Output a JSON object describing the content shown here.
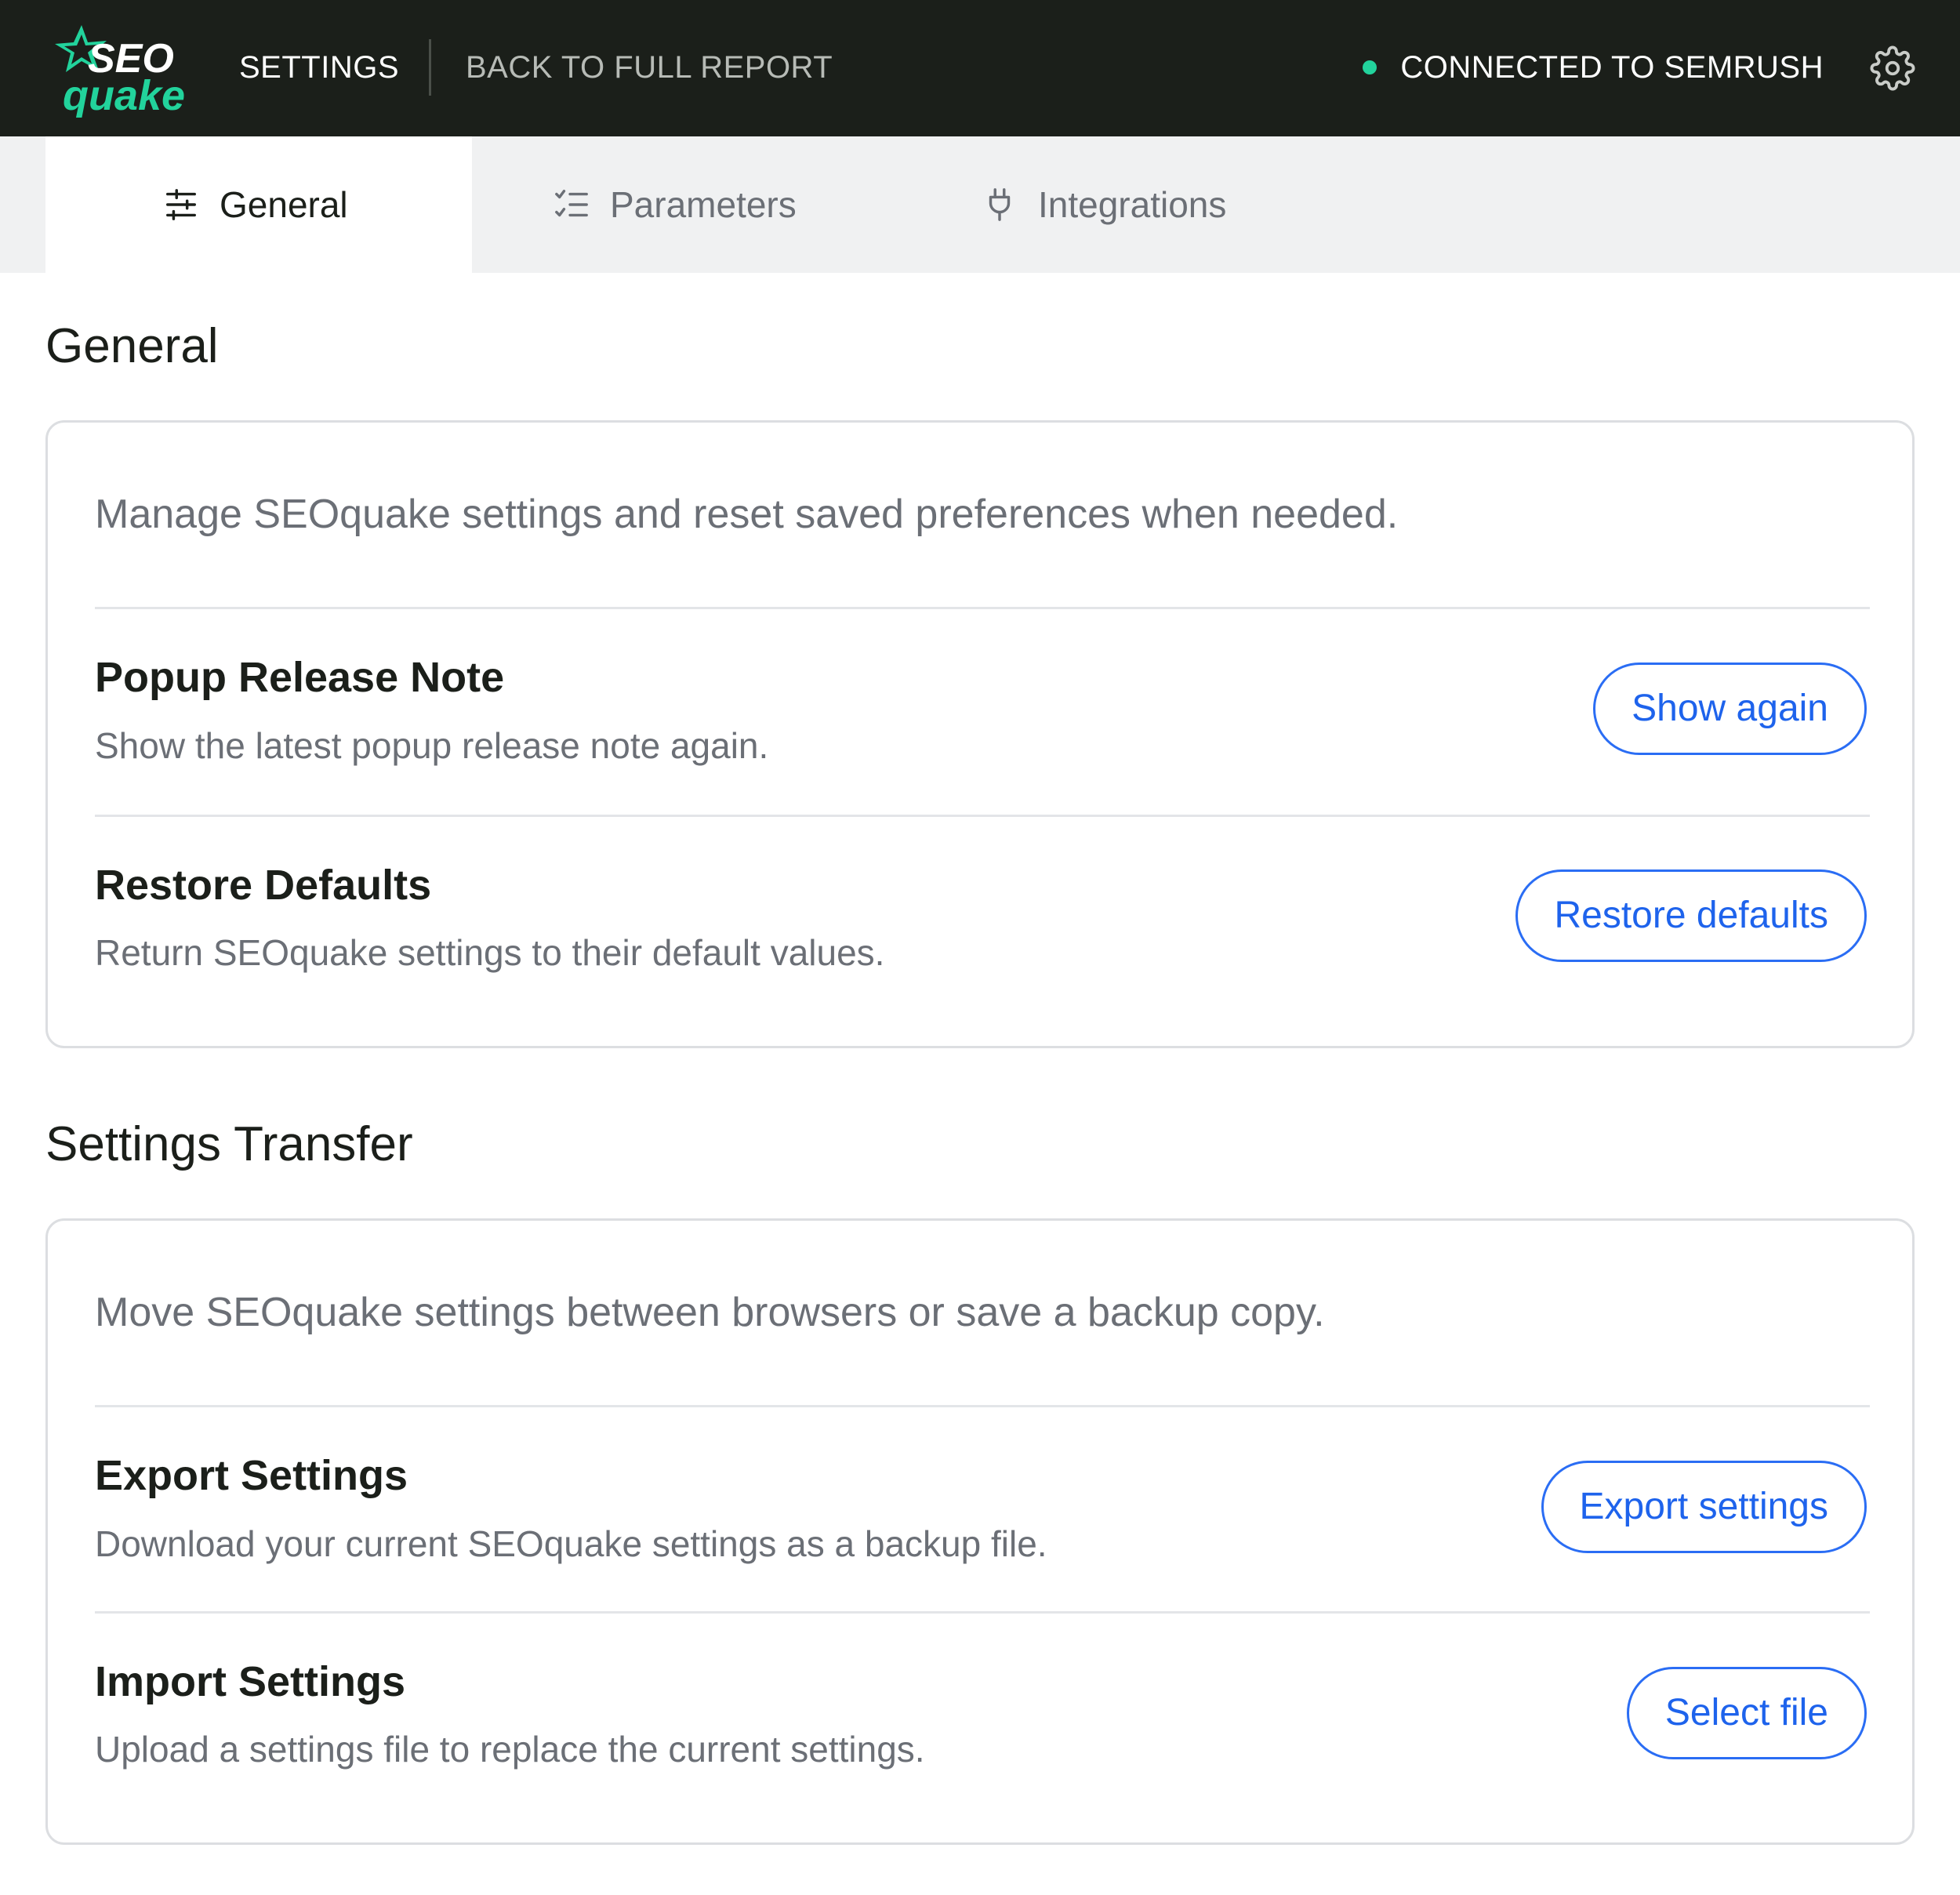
{
  "header": {
    "logo_text_top": "SEO",
    "logo_text_bottom": "quake",
    "nav_settings": "SETTINGS",
    "nav_back": "BACK TO FULL REPORT",
    "status_text": "CONNECTED TO SEMRUSH",
    "status_color": "#22d39c",
    "gear_icon": "gear-icon"
  },
  "tabs": [
    {
      "label": "General",
      "icon": "sliders-icon",
      "active": true
    },
    {
      "label": "Parameters",
      "icon": "checklist-icon",
      "active": false
    },
    {
      "label": "Integrations",
      "icon": "plug-icon",
      "active": false
    }
  ],
  "general": {
    "title": "General",
    "description": "Manage SEOquake settings and reset saved preferences when needed.",
    "rows": [
      {
        "title": "Popup Release Note",
        "subtitle": "Show the latest popup release note again.",
        "button": "Show again"
      },
      {
        "title": "Restore Defaults",
        "subtitle": "Return SEOquake settings to their default values.",
        "button": "Restore defaults"
      }
    ]
  },
  "transfer": {
    "title": "Settings Transfer",
    "description": "Move SEOquake settings between browsers or save a backup copy.",
    "rows": [
      {
        "title": "Export Settings",
        "subtitle": "Download your current SEOquake settings as a backup file.",
        "button": "Export settings"
      },
      {
        "title": "Import Settings",
        "subtitle": "Upload a settings file to replace the current settings.",
        "button": "Select file"
      }
    ]
  },
  "colors": {
    "header_bg": "#1b1f1a",
    "accent_green": "#22d39c",
    "link_blue": "#1e63ec"
  }
}
